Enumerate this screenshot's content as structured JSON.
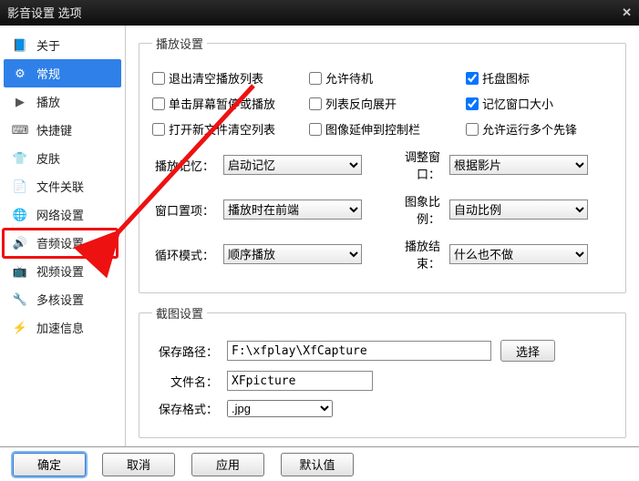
{
  "window": {
    "title": "影音设置 选项"
  },
  "sidebar": {
    "items": [
      {
        "label": "关于",
        "icon": "info"
      },
      {
        "label": "常规",
        "icon": "gear",
        "active": true
      },
      {
        "label": "播放",
        "icon": "play"
      },
      {
        "label": "快捷键",
        "icon": "keyboard"
      },
      {
        "label": "皮肤",
        "icon": "shirt"
      },
      {
        "label": "文件关联",
        "icon": "file"
      },
      {
        "label": "网络设置",
        "icon": "globe",
        "highlight": true
      },
      {
        "label": "音频设置",
        "icon": "speaker"
      },
      {
        "label": "视频设置",
        "icon": "tv"
      },
      {
        "label": "多核设置",
        "icon": "cpu"
      },
      {
        "label": "加速信息",
        "icon": "bolt"
      }
    ]
  },
  "groups": {
    "playback": {
      "legend": "播放设置",
      "checks": [
        [
          {
            "label": "退出清空播放列表",
            "checked": false
          },
          {
            "label": "允许待机",
            "checked": false
          },
          {
            "label": "托盘图标",
            "checked": true
          }
        ],
        [
          {
            "label": "单击屏幕暂停或播放",
            "checked": false
          },
          {
            "label": "列表反向展开",
            "checked": false
          },
          {
            "label": "记忆窗口大小",
            "checked": true
          }
        ],
        [
          {
            "label": "打开新文件清空列表",
            "checked": false
          },
          {
            "label": "图像延伸到控制栏",
            "checked": false
          },
          {
            "label": "允许运行多个先锋",
            "checked": false
          }
        ]
      ],
      "selects": [
        {
          "lbl": "播放记忆：",
          "value": "启动记忆",
          "lbl2": "调整窗口：",
          "value2": "根据影片"
        },
        {
          "lbl": "窗口置项：",
          "value": "播放时在前端",
          "lbl2": "图象比例：",
          "value2": "自动比例"
        },
        {
          "lbl": "循环模式：",
          "value": "顺序播放",
          "lbl2": "播放结束：",
          "value2": "什么也不做"
        }
      ]
    },
    "capture": {
      "legend": "截图设置",
      "path_label": "保存路径：",
      "path_value": "F:\\xfplay\\XfCapture",
      "browse": "选择",
      "filename_label": "文件名：",
      "filename_value": "XFpicture",
      "format_label": "保存格式：",
      "format_value": ".jpg"
    }
  },
  "footer": {
    "ok": "确定",
    "cancel": "取消",
    "apply": "应用",
    "default": "默认值"
  }
}
